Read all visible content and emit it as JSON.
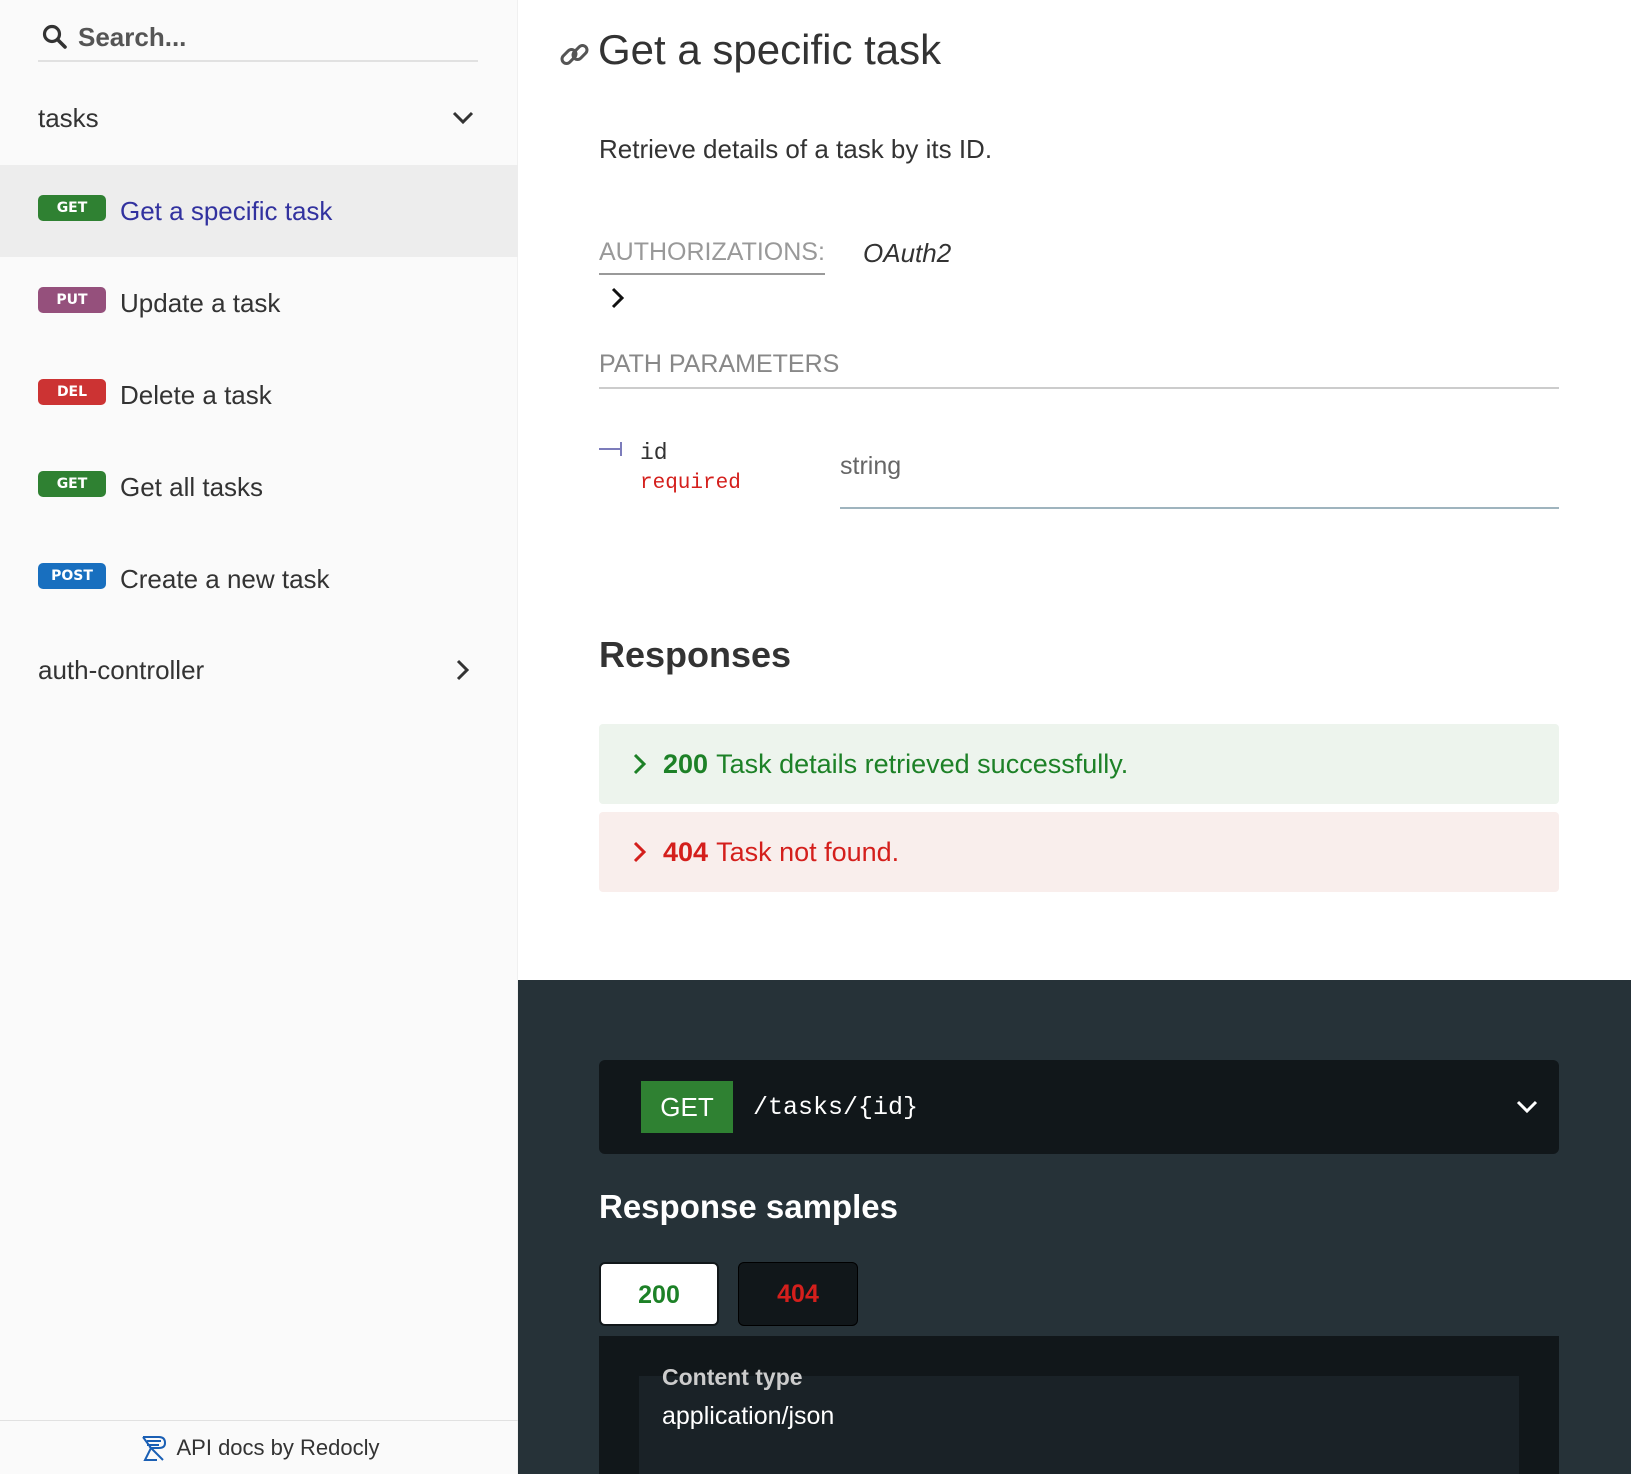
{
  "sidebar": {
    "search_placeholder": "Search...",
    "groups": [
      {
        "label": "tasks"
      },
      {
        "label": "auth-controller"
      }
    ],
    "items": [
      {
        "method": "GET",
        "label": "Get a specific task"
      },
      {
        "method": "PUT",
        "label": "Update a task"
      },
      {
        "method": "DEL",
        "label": "Delete a task"
      },
      {
        "method": "GET",
        "label": "Get all tasks"
      },
      {
        "method": "POST",
        "label": "Create a new task"
      }
    ],
    "footer": "API docs by Redocly"
  },
  "main": {
    "title": "Get a specific task",
    "description": "Retrieve details of a task by its ID.",
    "authorizations_label": "AUTHORIZATIONS:",
    "authorizations_value": "OAuth2",
    "path_params_heading": "PATH PARAMETERS",
    "param": {
      "name": "id",
      "required": "required",
      "type": "string"
    },
    "responses_title": "Responses",
    "responses": [
      {
        "code": "200",
        "text": "Task details retrieved successfully."
      },
      {
        "code": "404",
        "text": "Task not found."
      }
    ]
  },
  "panel": {
    "method": "GET",
    "path": "/tasks/{id}",
    "samples_title": "Response samples",
    "tabs": [
      "200",
      "404"
    ],
    "content_type_label": "Content type",
    "content_type_value": "application/json"
  },
  "colors": {
    "get": "#2f8132",
    "put": "#95507c",
    "del": "#cc3333",
    "post": "#186fbf",
    "success": "#1d8127",
    "error": "#d41f1c",
    "dark_panel": "#263238"
  }
}
